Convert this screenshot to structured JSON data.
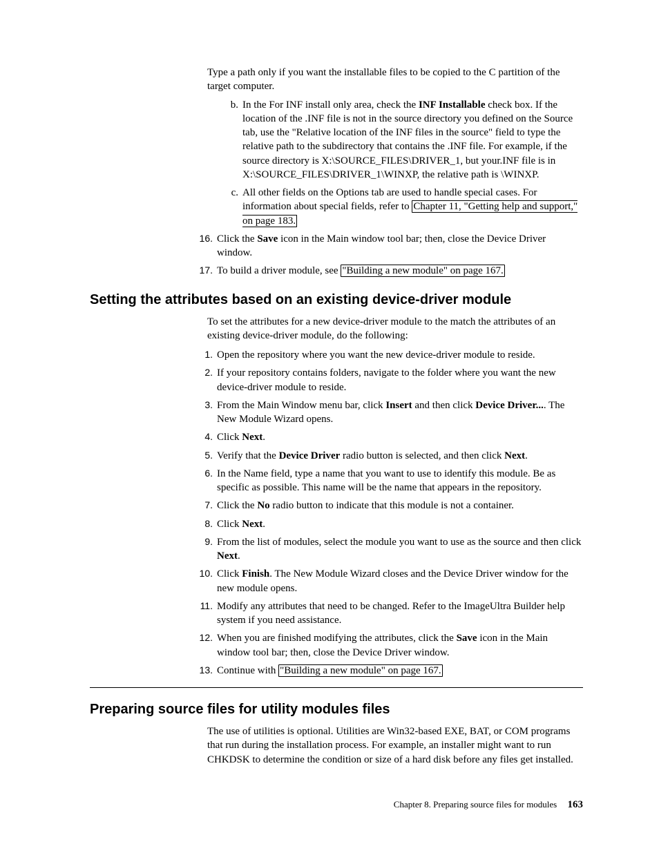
{
  "top": {
    "para_a": "Type a path only if you want the installable files to be copied to the C partition of the target computer.",
    "item_b_1": "In the For INF install only area, check the ",
    "item_b_bold": "INF Installable",
    "item_b_2": " check box. If the location of the .INF file is not in the source directory you defined on the Source tab, use the \"Relative location of the INF files in the source\" field to type the relative path to the subdirectory that contains the .INF file. For example, if the source directory is X:\\SOURCE_FILES\\DRIVER_1, but your.INF file is in X:\\SOURCE_FILES\\DRIVER_1\\WINXP, the relative path is \\WINXP.",
    "item_c_1": "All other fields on the Options tab are used to handle special cases. For information about special fields, refer to ",
    "item_c_link": "Chapter 11, \"Getting help and support,\" on page 183.",
    "item16_1": "Click the ",
    "item16_bold": "Save",
    "item16_2": " icon in the Main window tool bar; then, close the Device Driver window.",
    "item17_1": "To build a driver module, see ",
    "item17_link": "\"Building a new module\" on page 167."
  },
  "section1": {
    "heading": "Setting the attributes based on an existing device-driver module",
    "intro": "To set the attributes for a new device-driver module to the match the attributes of an existing device-driver module, do the following:",
    "s1": "Open the repository where you want the new device-driver module to reside.",
    "s2": "If your repository contains folders, navigate to the folder where you want the new device-driver module to reside.",
    "s3_a": "From the Main Window menu bar, click ",
    "s3_b1": "Insert",
    "s3_c": " and then click ",
    "s3_b2": "Device Driver...",
    "s3_d": ". The New Module Wizard opens.",
    "s4_a": "Click ",
    "s4_b": "Next",
    "s4_c": ".",
    "s5_a": "Verify that the ",
    "s5_b1": "Device Driver",
    "s5_c": " radio button is selected, and then click ",
    "s5_b2": "Next",
    "s5_d": ".",
    "s6": "In the Name field, type a name that you want to use to identify this module. Be as specific as possible. This name will be the name that appears in the repository.",
    "s7_a": "Click the ",
    "s7_b": "No",
    "s7_c": " radio button to indicate that this module is not a container.",
    "s8_a": " Click ",
    "s8_b": "Next",
    "s8_c": ".",
    "s9_a": "From the list of modules, select the module you want to use as the source and then click ",
    "s9_b": "Next",
    "s9_c": ".",
    "s10_a": "Click ",
    "s10_b": "Finish",
    "s10_c": ". The New Module Wizard closes and the Device Driver window for the new module opens.",
    "s11": "Modify any attributes that need to be changed. Refer to the ImageUltra Builder help system if you need assistance.",
    "s12_a": "When you are finished modifying the attributes, click the ",
    "s12_b": "Save",
    "s12_c": " icon in the Main window tool bar; then, close the Device Driver window.",
    "s13_a": "Continue with ",
    "s13_link": "\"Building a new module\" on page 167."
  },
  "section2": {
    "heading": "Preparing source files for utility modules files",
    "para": "The use of utilities is optional. Utilities are Win32-based EXE, BAT, or COM programs that run during the installation process. For example, an installer might want to run CHKDSK to determine the condition or size of a hard disk before any files get installed."
  },
  "footer": {
    "chapter": "Chapter 8. Preparing source files for modules",
    "page": "163"
  },
  "markers": {
    "b": "b.",
    "c": "c.",
    "n16": "16.",
    "n17": "17.",
    "m1": "1.",
    "m2": "2.",
    "m3": "3.",
    "m4": "4.",
    "m5": "5.",
    "m6": "6.",
    "m7": "7.",
    "m8": "8.",
    "m9": "9.",
    "m10": "10.",
    "m11": "11.",
    "m12": "12.",
    "m13": "13."
  }
}
